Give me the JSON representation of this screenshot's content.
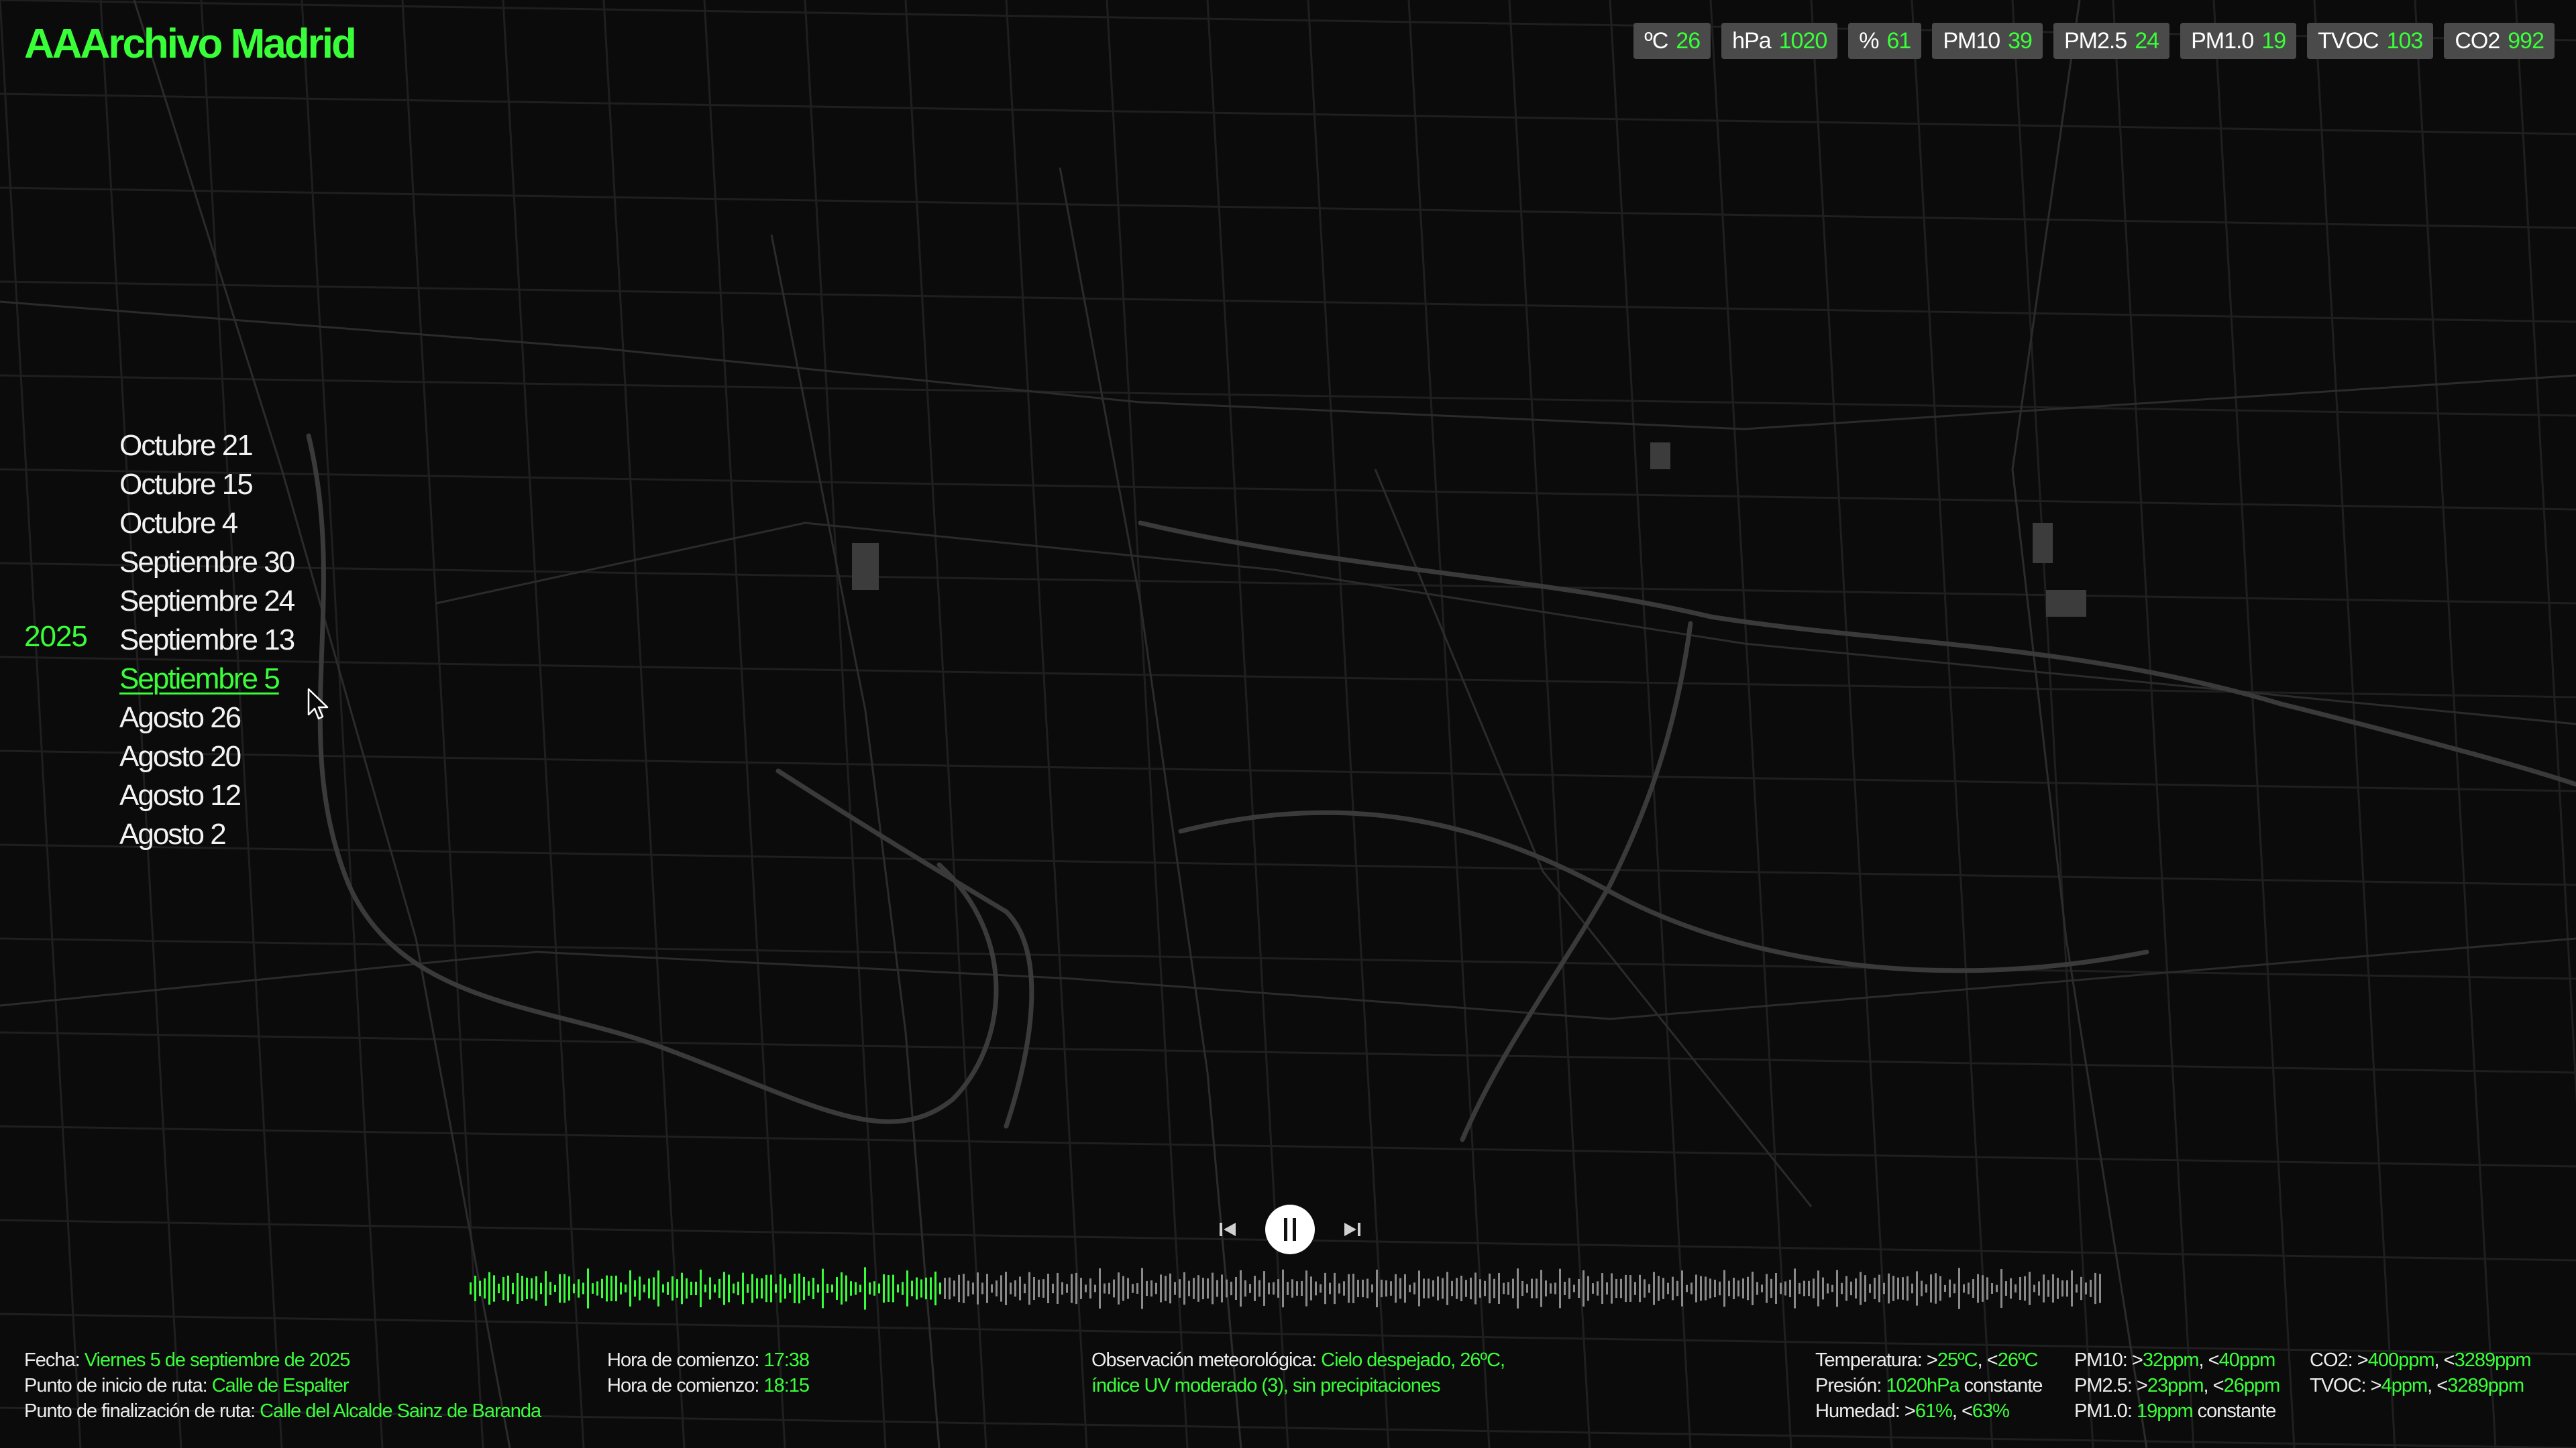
{
  "app_title": "AAArchivo Madrid",
  "accent_color": "#39ff39",
  "sensors": [
    {
      "label": "ºC",
      "value": "26"
    },
    {
      "label": "hPa",
      "value": "1020"
    },
    {
      "label": "%",
      "value": "61"
    },
    {
      "label": "PM10",
      "value": "39"
    },
    {
      "label": "PM2.5",
      "value": "24"
    },
    {
      "label": "PM1.0",
      "value": "19"
    },
    {
      "label": "TVOC",
      "value": "103"
    },
    {
      "label": "CO2",
      "value": "992"
    }
  ],
  "year": "2025",
  "dates": [
    "Octubre 21",
    "Octubre 15",
    "Octubre 4",
    "Septiembre 30",
    "Septiembre 24",
    "Septiembre 13",
    "Septiembre 5",
    "Agosto 26",
    "Agosto 20",
    "Agosto 12",
    "Agosto 2"
  ],
  "selected_date": "Septiembre 5",
  "player": {
    "prev_icon": "skip-back-icon",
    "pause_icon": "pause-icon",
    "next_icon": "skip-forward-icon",
    "progress": 0.29
  },
  "info": {
    "fecha_label": "Fecha:",
    "fecha_value": "Viernes 5 de septiembre de 2025",
    "inicio_label": "Punto de inicio de ruta:",
    "inicio_value": "Calle de Espalter",
    "fin_label": "Punto de finalización de ruta:",
    "fin_value": "Calle del Alcalde Sainz de Baranda",
    "hora1_label": "Hora de comienzo:",
    "hora1_value": "17:38",
    "hora2_label": "Hora de comienzo:",
    "hora2_value": "18:15",
    "obs_label": "Observación meteorológica:",
    "obs_value_1": "Cielo despejado, 26ºC,",
    "obs_value_2": "índice UV moderado (3), sin precipitaciones"
  },
  "summary": {
    "temp_label": "Temperatura:",
    "temp_gt": "25ºC",
    "temp_lt": "26ºC",
    "pres_label": "Presión:",
    "pres_value": "1020hPa",
    "pres_suffix": "constante",
    "hum_label": "Humedad:",
    "hum_gt": "61%",
    "hum_lt": "63%",
    "pm10_label": "PM10:",
    "pm10_gt": "32ppm",
    "pm10_lt": "40ppm",
    "pm25_label": "PM2.5:",
    "pm25_gt": "23ppm",
    "pm25_lt": "26ppm",
    "pm1_label": "PM1.0:",
    "pm1_value": "19ppm",
    "pm1_suffix": "constante",
    "co2_label": "CO2:",
    "co2_gt": "400ppm",
    "co2_lt": "3289ppm",
    "tvoc_label": "TVOC:",
    "tvoc_gt": "4ppm",
    "tvoc_lt": "3289ppm"
  }
}
